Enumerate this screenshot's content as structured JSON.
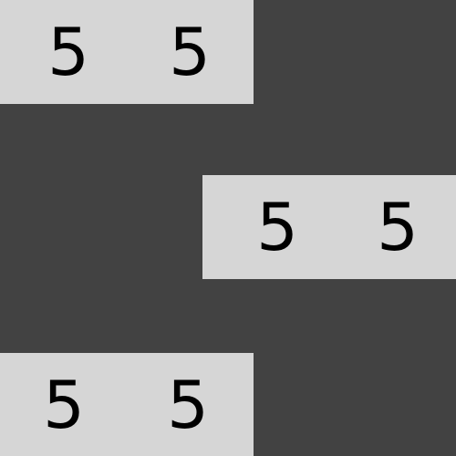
{
  "board": {
    "background_color": "#424242",
    "tile_color": "#d6d6d6",
    "text_color": "#000000",
    "rows": [
      {
        "values": [
          "5",
          "5"
        ]
      },
      {
        "values": [
          "5",
          "5"
        ]
      },
      {
        "values": [
          "5",
          "5"
        ]
      }
    ]
  }
}
